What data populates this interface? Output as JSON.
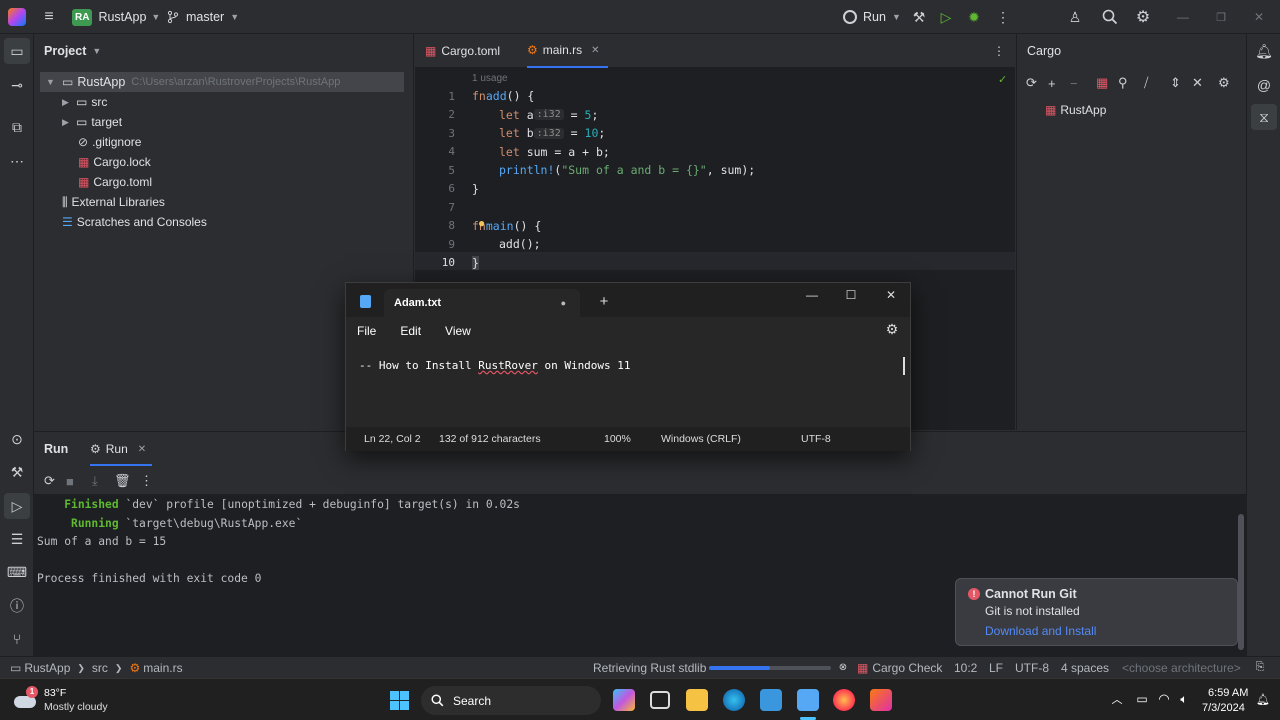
{
  "titlebar": {
    "project_badge": "RA",
    "project_name": "RustApp",
    "branch": "master",
    "run_label": "Run"
  },
  "project_panel": {
    "title": "Project",
    "root_name": "RustApp",
    "root_path": "C:\\Users\\arzan\\RustroverProjects\\RustApp",
    "items": [
      {
        "label": "src"
      },
      {
        "label": "target"
      },
      {
        "label": ".gitignore"
      },
      {
        "label": "Cargo.lock"
      },
      {
        "label": "Cargo.toml"
      },
      {
        "label": "External Libraries"
      },
      {
        "label": "Scratches and Consoles"
      }
    ]
  },
  "editor": {
    "tabs": [
      {
        "label": "Cargo.toml"
      },
      {
        "label": "main.rs"
      }
    ],
    "usage_hint": "1 usage",
    "line_numbers": [
      "1",
      "2",
      "3",
      "4",
      "5",
      "6",
      "7",
      "8",
      "9",
      "10"
    ],
    "code": {
      "l1_kw": "fn",
      "l1_name": "add",
      "l1_rest": "() {",
      "l2_kw": "let",
      "l2_var": " a",
      "l2_hint": ":i32",
      "l2_eq": " = ",
      "l2_val": "5",
      "l2_end": ";",
      "l3_kw": "let",
      "l3_var": " b",
      "l3_hint": ":i32",
      "l3_eq": " = ",
      "l3_val": "10",
      "l3_end": ";",
      "l4_kw": "let",
      "l4_rest": " sum = a + b;",
      "l5_mac": "println!",
      "l5_open": "(",
      "l5_str": "\"Sum of a and b = {}\"",
      "l5_rest": ", sum);",
      "l6": "}",
      "l8_kw": "fn",
      "l8_name": "main",
      "l8_rest": "() {",
      "l9": "add();",
      "l10": "}"
    }
  },
  "cargo_panel": {
    "title": "Cargo",
    "item": "RustApp"
  },
  "run_panel": {
    "title": "Run",
    "tab": "Run",
    "console": {
      "line1_word": "Finished",
      "line1_rest": " `dev` profile [unoptimized + debuginfo] target(s) in 0.02s",
      "line2_word": "Running",
      "line2_rest": " `target\\debug\\RustApp.exe`",
      "line3": "Sum of a and b = 15",
      "line4": "Process finished with exit code 0"
    }
  },
  "notepad": {
    "tab_title": "Adam.txt",
    "menu": [
      "File",
      "Edit",
      "View"
    ],
    "text_prefix": "-- How to Install ",
    "text_underlined": "RustRover",
    "text_suffix": " on Windows 11",
    "status": {
      "position": "Ln 22, Col 2",
      "chars": "132 of 912 characters",
      "zoom": "100%",
      "eol": "Windows (CRLF)",
      "encoding": "UTF-8"
    }
  },
  "notification": {
    "title": "Cannot Run Git",
    "body": "Git is not installed",
    "link": "Download and Install"
  },
  "statusbar": {
    "crumbs": [
      "RustApp",
      "src",
      "main.rs"
    ],
    "progress_label": "Retrieving Rust stdlib",
    "progress": 0.5,
    "cargo_check": "Cargo Check",
    "position": "10:2",
    "eol": "LF",
    "encoding": "UTF-8",
    "indent": "4 spaces",
    "architecture": "<choose architecture>"
  },
  "taskbar": {
    "weather_badge": "1",
    "temperature": "83°F",
    "weather": "Mostly cloudy",
    "search": "Search",
    "time": "6:59 AM",
    "date": "7/3/2024"
  },
  "colors": {
    "accent": "#3574f0",
    "keyword": "#cf8e6d",
    "function": "#56a8f5",
    "number": "#2aacb8",
    "string": "#6aab73",
    "finished": "#5fb832",
    "error": "#e55765"
  }
}
